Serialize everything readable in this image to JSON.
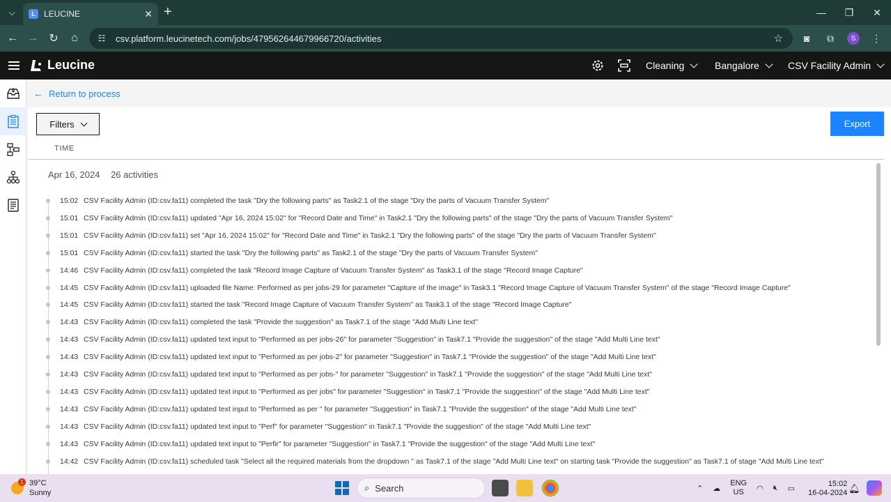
{
  "browser": {
    "tab_title": "LEUCINE",
    "url": "csv.platform.leucinetech.com/jobs/479562644679966720/activities",
    "profile_initial": "S"
  },
  "header": {
    "brand": "Leucine",
    "use_case": "Cleaning",
    "facility": "Bangalore",
    "user_role": "CSV Facility Admin"
  },
  "page": {
    "back_label": "Return to process",
    "filters_label": "Filters",
    "export_label": "Export",
    "column_time": "TIME",
    "date": "Apr 16, 2024",
    "activity_count": "26 activities"
  },
  "activities": [
    {
      "time": "15:02",
      "text": "CSV Facility Admin (ID:csv.fa11) completed the task \"Dry the following parts\" as Task2.1 of the stage \"Dry the parts of Vacuum Transfer System\""
    },
    {
      "time": "15:01",
      "text": "CSV Facility Admin (ID:csv.fa11) updated \"Apr 16, 2024 15:02\" for \"Record Date and Time\" in Task2.1 \"Dry the following parts\" of the stage \"Dry the parts of Vacuum Transfer System\""
    },
    {
      "time": "15:01",
      "text": "CSV Facility Admin (ID:csv.fa11) set \"Apr 16, 2024 15:02\" for \"Record Date and Time\" in Task2.1 \"Dry the following parts\" of the stage \"Dry the parts of Vacuum Transfer System\""
    },
    {
      "time": "15:01",
      "text": "CSV Facility Admin (ID:csv.fa11) started the task \"Dry the following parts\" as Task2.1 of the stage \"Dry the parts of Vacuum Transfer System\""
    },
    {
      "time": "14:46",
      "text": "CSV Facility Admin (ID:csv.fa11) completed the task \"Record Image Capture of Vacuum Transfer System\" as Task3.1 of the stage \"Record Image Capture\""
    },
    {
      "time": "14:45",
      "text": "CSV Facility Admin (ID:csv.fa11) uploaded file Name: Performed as per jobs-29 for parameter \"Capture of the image\" in Task3.1 \"Record Image Capture of Vacuum Transfer System\" of the stage \"Record Image Capture\""
    },
    {
      "time": "14:45",
      "text": "CSV Facility Admin (ID:csv.fa11) started the task \"Record Image Capture of Vacuum Transfer System\" as Task3.1 of the stage \"Record Image Capture\""
    },
    {
      "time": "14:43",
      "text": "CSV Facility Admin (ID:csv.fa11) completed the task \"Provide the suggestion\" as Task7.1 of the stage \"Add Multi Line text\""
    },
    {
      "time": "14:43",
      "text": "CSV Facility Admin (ID:csv.fa11) updated text input to \"Performed as per jobs-26\" for parameter \"Suggestion\" in Task7.1 \"Provide the suggestion\" of the stage \"Add Multi Line text\""
    },
    {
      "time": "14:43",
      "text": "CSV Facility Admin (ID:csv.fa11) updated text input to \"Performed as per jobs-2\" for parameter \"Suggestion\" in Task7.1 \"Provide the suggestion\" of the stage \"Add Multi Line text\""
    },
    {
      "time": "14:43",
      "text": "CSV Facility Admin (ID:csv.fa11) updated text input to \"Performed as per jobs-\" for parameter \"Suggestion\" in Task7.1 \"Provide the suggestion\" of the stage \"Add Multi Line text\""
    },
    {
      "time": "14:43",
      "text": "CSV Facility Admin (ID:csv.fa11) updated text input to \"Performed as per jobs\" for parameter \"Suggestion\" in Task7.1 \"Provide the suggestion\" of the stage \"Add Multi Line text\""
    },
    {
      "time": "14:43",
      "text": "CSV Facility Admin (ID:csv.fa11) updated text input to \"Performed as per \" for parameter \"Suggestion\" in Task7.1 \"Provide the suggestion\" of the stage \"Add Multi Line text\""
    },
    {
      "time": "14:43",
      "text": "CSV Facility Admin (ID:csv.fa11) updated text input to \"Perf\" for parameter \"Suggestion\" in Task7.1 \"Provide the suggestion\" of the stage \"Add Multi Line text\""
    },
    {
      "time": "14:43",
      "text": "CSV Facility Admin (ID:csv.fa11) updated text input to \"Perfir\" for parameter \"Suggestion\" in Task7.1 \"Provide the suggestion\" of the stage \"Add Multi Line text\""
    },
    {
      "time": "14:42",
      "text": "CSV Facility Admin (ID:csv.fa11) scheduled task \"Select all the required materials from the dropdown \" as Task7.1 of the stage \"Add Multi Line text\" on starting task \"Provide the suggestion\" as Task7.1 of stage \"Add Multi Line text\""
    }
  ],
  "taskbar": {
    "temperature": "39°C",
    "weather": "Sunny",
    "weather_badge": "1",
    "search_label": "Search",
    "lang_line1": "ENG",
    "lang_line2": "US",
    "time": "15:02",
    "date": "16-04-2024"
  },
  "colors": {
    "accent": "#1d84ff",
    "header_bg": "#161616",
    "browser_bg": "#2c4f4b"
  }
}
